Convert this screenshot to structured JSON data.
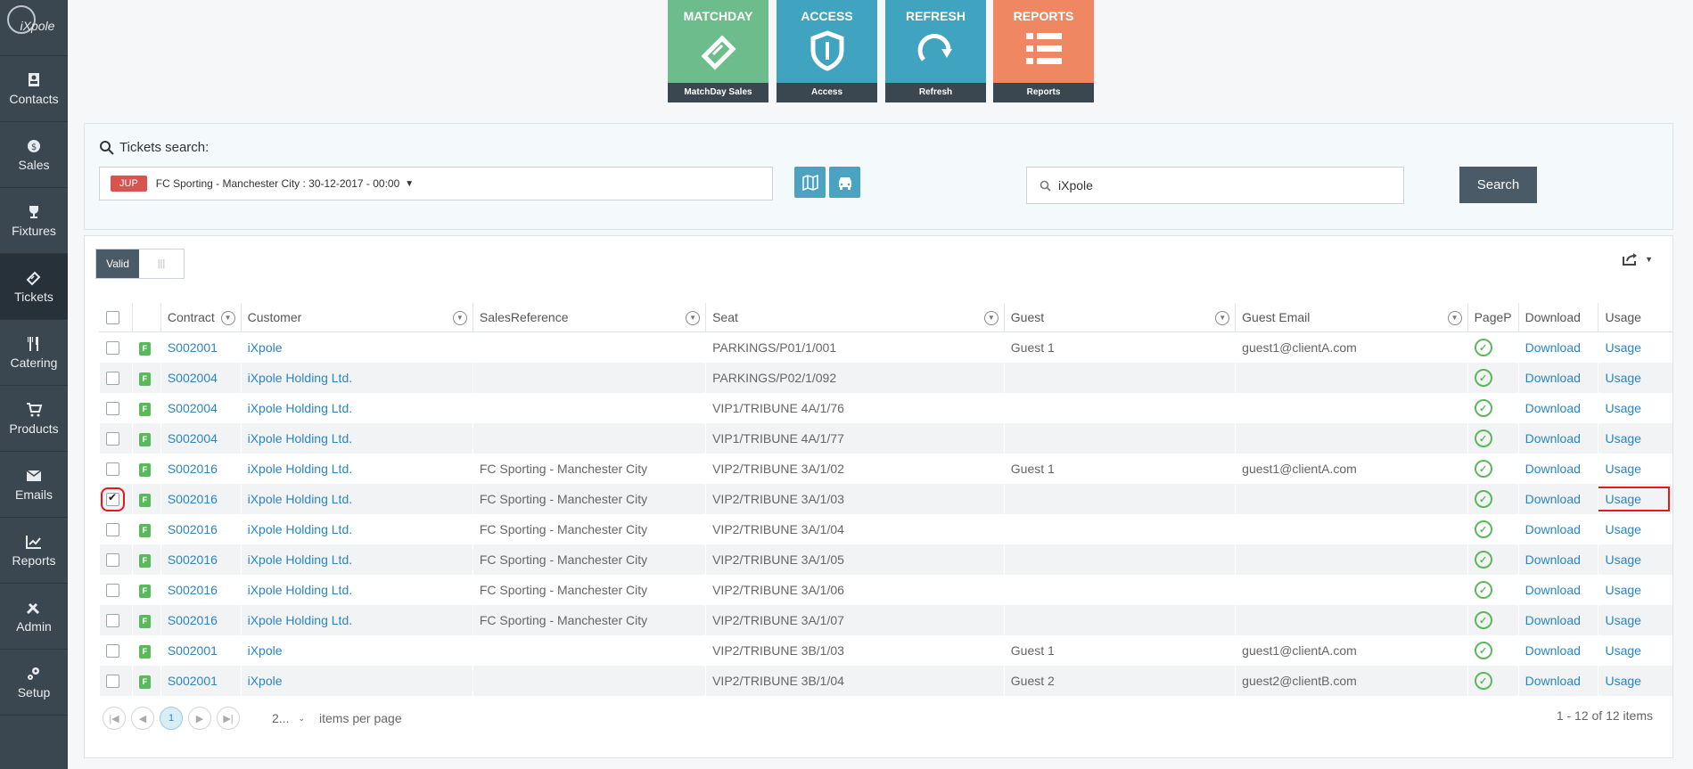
{
  "logo": "iXpole",
  "nav": [
    "Contacts",
    "Sales",
    "Fixtures",
    "Tickets",
    "Catering",
    "Products",
    "Emails",
    "Reports",
    "Admin",
    "Setup"
  ],
  "tiles": [
    {
      "title": "MATCHDAY",
      "footer": "MatchDay Sales",
      "color": "#6dbd8c"
    },
    {
      "title": "ACCESS",
      "footer": "Access",
      "color": "#40a3bf"
    },
    {
      "title": "REFRESH",
      "footer": "Refresh",
      "color": "#40a3bf"
    },
    {
      "title": "REPORTS",
      "footer": "Reports",
      "color": "#f08763"
    }
  ],
  "search": {
    "title": "Tickets search:",
    "badge": "JUP",
    "event": "FC Sporting - Manchester City : 30-12-2017 - 00:00",
    "query": "iXpole",
    "button": "Search"
  },
  "toggle_label": "Valid",
  "columns": [
    "Contract",
    "Customer",
    "SalesReference",
    "Seat",
    "Guest",
    "Guest Email",
    "PageP",
    "Download",
    "Usage"
  ],
  "rows": [
    {
      "contract": "S002001",
      "customer": "iXpole",
      "ref": "",
      "seat": "PARKINGS/P01/1/001",
      "guest": "Guest 1",
      "email": "guest1@clientA.com",
      "download": "Download",
      "usage": "Usage",
      "checked": false
    },
    {
      "contract": "S002004",
      "customer": "iXpole Holding Ltd.",
      "ref": "",
      "seat": "PARKINGS/P02/1/092",
      "guest": "",
      "email": "",
      "download": "Download",
      "usage": "Usage",
      "checked": false
    },
    {
      "contract": "S002004",
      "customer": "iXpole Holding Ltd.",
      "ref": "",
      "seat": "VIP1/TRIBUNE 4A/1/76",
      "guest": "",
      "email": "",
      "download": "Download",
      "usage": "Usage",
      "checked": false
    },
    {
      "contract": "S002004",
      "customer": "iXpole Holding Ltd.",
      "ref": "",
      "seat": "VIP1/TRIBUNE 4A/1/77",
      "guest": "",
      "email": "",
      "download": "Download",
      "usage": "Usage",
      "checked": false
    },
    {
      "contract": "S002016",
      "customer": "iXpole Holding Ltd.",
      "ref": "FC Sporting - Manchester City",
      "seat": "VIP2/TRIBUNE 3A/1/02",
      "guest": "Guest 1",
      "email": "guest1@clientA.com",
      "download": "Download",
      "usage": "Usage",
      "checked": false
    },
    {
      "contract": "S002016",
      "customer": "iXpole Holding Ltd.",
      "ref": "FC Sporting - Manchester City",
      "seat": "VIP2/TRIBUNE 3A/1/03",
      "guest": "",
      "email": "",
      "download": "Download",
      "usage": "Usage",
      "checked": true
    },
    {
      "contract": "S002016",
      "customer": "iXpole Holding Ltd.",
      "ref": "FC Sporting - Manchester City",
      "seat": "VIP2/TRIBUNE 3A/1/04",
      "guest": "",
      "email": "",
      "download": "Download",
      "usage": "Usage",
      "checked": false
    },
    {
      "contract": "S002016",
      "customer": "iXpole Holding Ltd.",
      "ref": "FC Sporting - Manchester City",
      "seat": "VIP2/TRIBUNE 3A/1/05",
      "guest": "",
      "email": "",
      "download": "Download",
      "usage": "Usage",
      "checked": false
    },
    {
      "contract": "S002016",
      "customer": "iXpole Holding Ltd.",
      "ref": "FC Sporting - Manchester City",
      "seat": "VIP2/TRIBUNE 3A/1/06",
      "guest": "",
      "email": "",
      "download": "Download",
      "usage": "Usage",
      "checked": false
    },
    {
      "contract": "S002016",
      "customer": "iXpole Holding Ltd.",
      "ref": "FC Sporting - Manchester City",
      "seat": "VIP2/TRIBUNE 3A/1/07",
      "guest": "",
      "email": "",
      "download": "Download",
      "usage": "Usage",
      "checked": false
    },
    {
      "contract": "S002001",
      "customer": "iXpole",
      "ref": "",
      "seat": "VIP2/TRIBUNE 3B/1/03",
      "guest": "Guest 1",
      "email": "guest1@clientA.com",
      "download": "Download",
      "usage": "Usage",
      "checked": false
    },
    {
      "contract": "S002001",
      "customer": "iXpole",
      "ref": "",
      "seat": "VIP2/TRIBUNE 3B/1/04",
      "guest": "Guest 2",
      "email": "guest2@clientB.com",
      "download": "Download",
      "usage": "Usage",
      "checked": false
    }
  ],
  "row_badge": "F",
  "pager": {
    "current": "1",
    "page_size": "2...",
    "items_per_page": "items per page",
    "summary": "1 - 12 of 12 items"
  }
}
